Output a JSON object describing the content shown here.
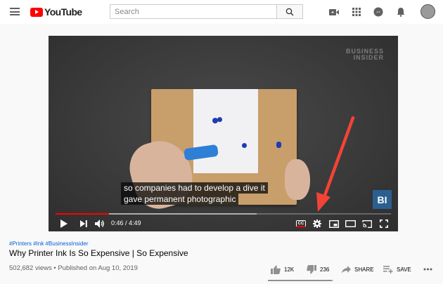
{
  "header": {
    "logo_text": "YouTube",
    "search_placeholder": "Search",
    "icons": [
      "menu-icon",
      "create-video-icon",
      "apps-grid-icon",
      "messages-icon",
      "notifications-bell-icon",
      "account-avatar"
    ]
  },
  "video": {
    "watermark_line1": "BUSINESS",
    "watermark_line2": "INSIDER",
    "channel_badge": "BI",
    "captions": [
      "so companies had to develop a dive it",
      "gave permanent photographic"
    ],
    "time_current": "0:46",
    "time_total": "4:49",
    "time_display": "0:46 / 4:49",
    "progress_played_fraction": 0.159,
    "cc_label": "CC",
    "controls": [
      "play-icon",
      "next-icon",
      "volume-icon",
      "captions-icon",
      "settings-icon",
      "miniplayer-icon",
      "theater-mode-icon",
      "cast-icon",
      "fullscreen-icon"
    ]
  },
  "info": {
    "hashtags": "#Printers #Ink #BusinessInsider",
    "title": "Why Printer Ink Is So Expensive | So Expensive",
    "views_date": "502,682 views • Published on Aug 10, 2019",
    "likes": "12K",
    "dislikes": "236",
    "like_ratio": 0.98,
    "share_label": "SHARE",
    "save_label": "SAVE"
  },
  "annotation_color": "#f44336"
}
